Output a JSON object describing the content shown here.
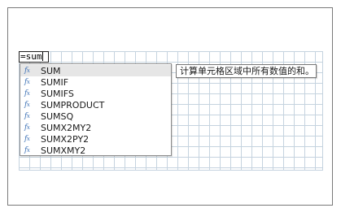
{
  "formula": {
    "value": "=sum"
  },
  "autocomplete": {
    "icon": "function-icon",
    "items": [
      {
        "label": "SUM"
      },
      {
        "label": "SUMIF"
      },
      {
        "label": "SUMIFS"
      },
      {
        "label": "SUMPRODUCT"
      },
      {
        "label": "SUMSQ"
      },
      {
        "label": "SUMX2MY2"
      },
      {
        "label": "SUMX2PY2"
      },
      {
        "label": "SUMXMY2"
      }
    ],
    "selected_index": 0
  },
  "tooltip": {
    "text": "计算单元格区域中所有数值的和。"
  },
  "colors": {
    "grid_line": "#c5d3df",
    "selected_row": "#e6e6e6",
    "fx_icon": "#3a6fb5"
  }
}
